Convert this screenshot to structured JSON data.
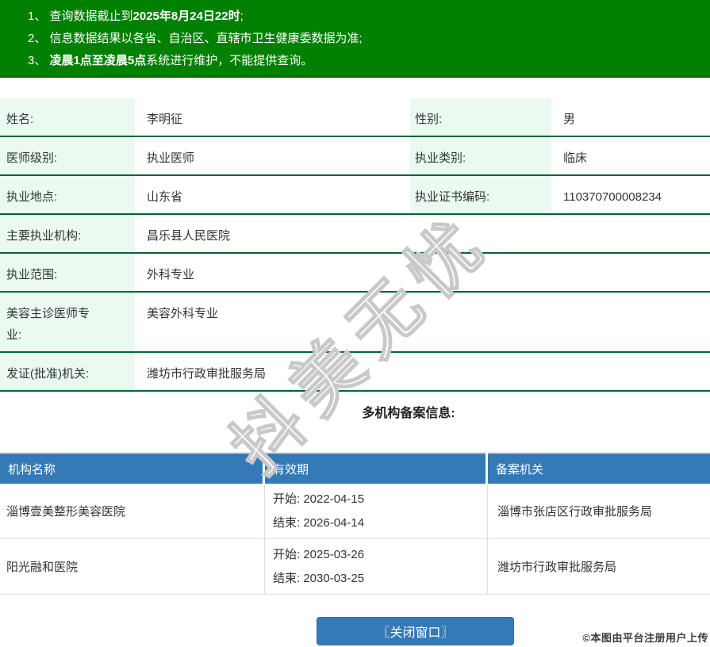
{
  "banner": {
    "lines": [
      {
        "num": "1、 ",
        "pre": "查询数据截止到",
        "bold": "2025年8月24日22时",
        "post": ";"
      },
      {
        "num": "2、 ",
        "pre": "信息数据结果以各省、自治区、直辖市卫生健康委数据为准;",
        "bold": "",
        "post": ""
      },
      {
        "num": "3、 ",
        "pre": "",
        "bold": "凌晨1点至凌晨5点",
        "post": "系统进行维护，不能提供查询。"
      }
    ]
  },
  "doctor": {
    "row1": {
      "label": "姓名:",
      "value": "李明征",
      "label2": "性别:",
      "value2": "男"
    },
    "row2": {
      "label": "医师级别:",
      "value": "执业医师",
      "label2": "执业类别:",
      "value2": "临床"
    },
    "row3": {
      "label": "执业地点:",
      "value": "山东省",
      "label2": "执业证书编码:",
      "value2": "110370700008234"
    },
    "row4": {
      "label": "主要执业机构:",
      "value": "昌乐县人民医院"
    },
    "row5": {
      "label": "执业范围:",
      "value": "外科专业"
    },
    "row6": {
      "label": "美容主诊医师专业:",
      "value": "美容外科专业"
    },
    "row7": {
      "label": "发证(批准)机关:",
      "value": "潍坊市行政审批服务局"
    }
  },
  "section": {
    "title": "多机构备案信息:"
  },
  "org_table": {
    "header": {
      "col1": "机构名称",
      "col2": "有效期",
      "col3": "备案机关"
    },
    "row1": {
      "name": "淄博壹美整形美容医院",
      "start_label": "开始:",
      "start_date": "2022-04-15",
      "end_label": "结束:",
      "end_date": "2026-04-14",
      "authority": "淄博市张店区行政审批服务局"
    },
    "row2": {
      "name": "阳光融和医院",
      "start_label": "开始:",
      "start_date": "2025-03-26",
      "end_label": "结束:",
      "end_date": "2030-03-25",
      "authority": "潍坊市行政审批服务局"
    }
  },
  "footer": {
    "close_button": "〖关闭窗口〗",
    "attribution": "©本图由平台注册用户上传"
  },
  "watermark": {
    "text": "抖美无忧"
  },
  "colors": {
    "banner_green": "#008000",
    "row_border_green": "#006633",
    "label_bg_mint": "#eafaf1",
    "table_header_blue": "#337ab7",
    "button_blue": "#337ab7"
  }
}
